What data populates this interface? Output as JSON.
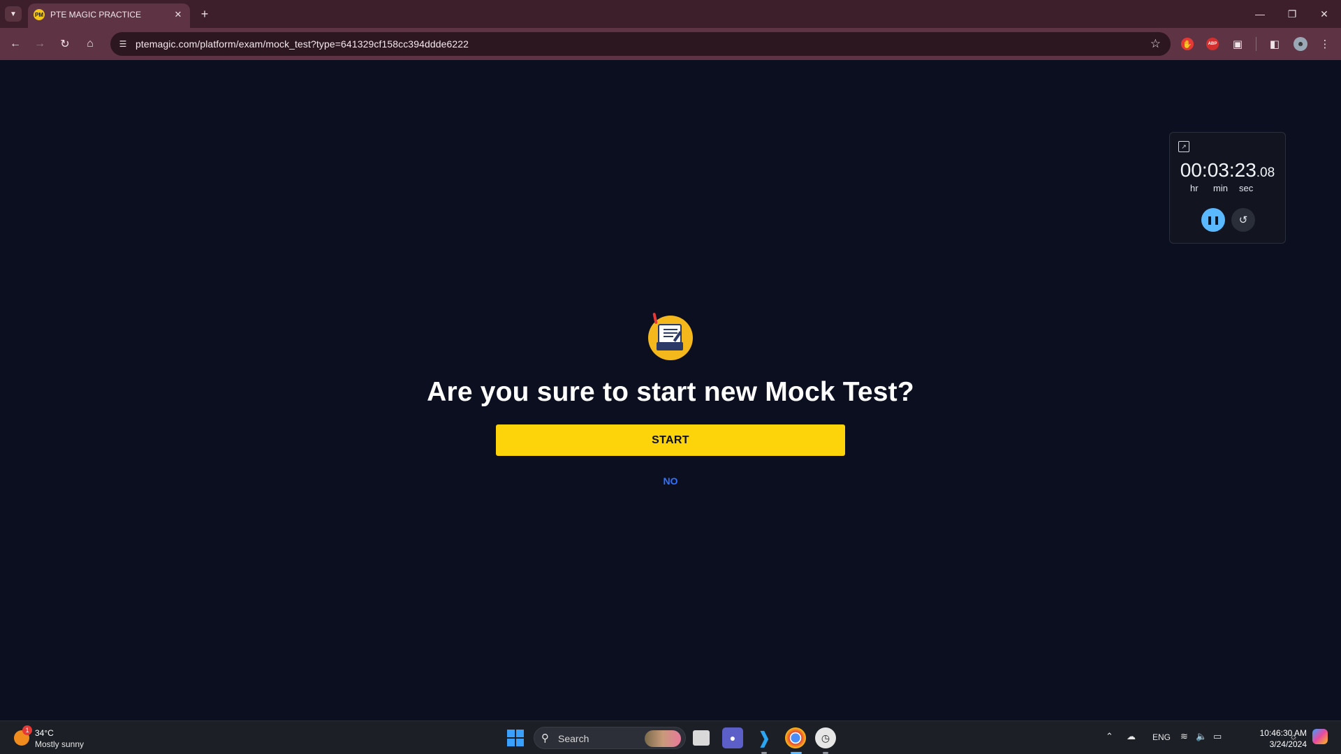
{
  "browser": {
    "tab_title": "PTE MAGIC PRACTICE",
    "tab_favicon_text": "PM",
    "new_tab_label": "+",
    "url": "ptemagic.com/platform/exam/mock_test?type=641329cf158cc394ddde6222",
    "ext_abp_label": "ABP"
  },
  "page": {
    "headline": "Are you sure to start new Mock Test?",
    "start_label": "START",
    "no_label": "NO"
  },
  "stopwatch": {
    "time_main": "00:03:23",
    "time_fraction": ".08",
    "unit_hr": "hr",
    "unit_min": "min",
    "unit_sec": "sec"
  },
  "taskbar": {
    "weather_temp": "34°C",
    "weather_desc": "Mostly sunny",
    "weather_badge": "1",
    "search_placeholder": "Search",
    "language": "ENG",
    "time": "10:46:30 AM",
    "date": "3/24/2024"
  },
  "colors": {
    "page_bg": "#0b0f1f",
    "start_button": "#fdd30a",
    "no_link": "#2f73ff",
    "browser_frame": "#5e3444",
    "pause_button": "#5ab8ff"
  }
}
